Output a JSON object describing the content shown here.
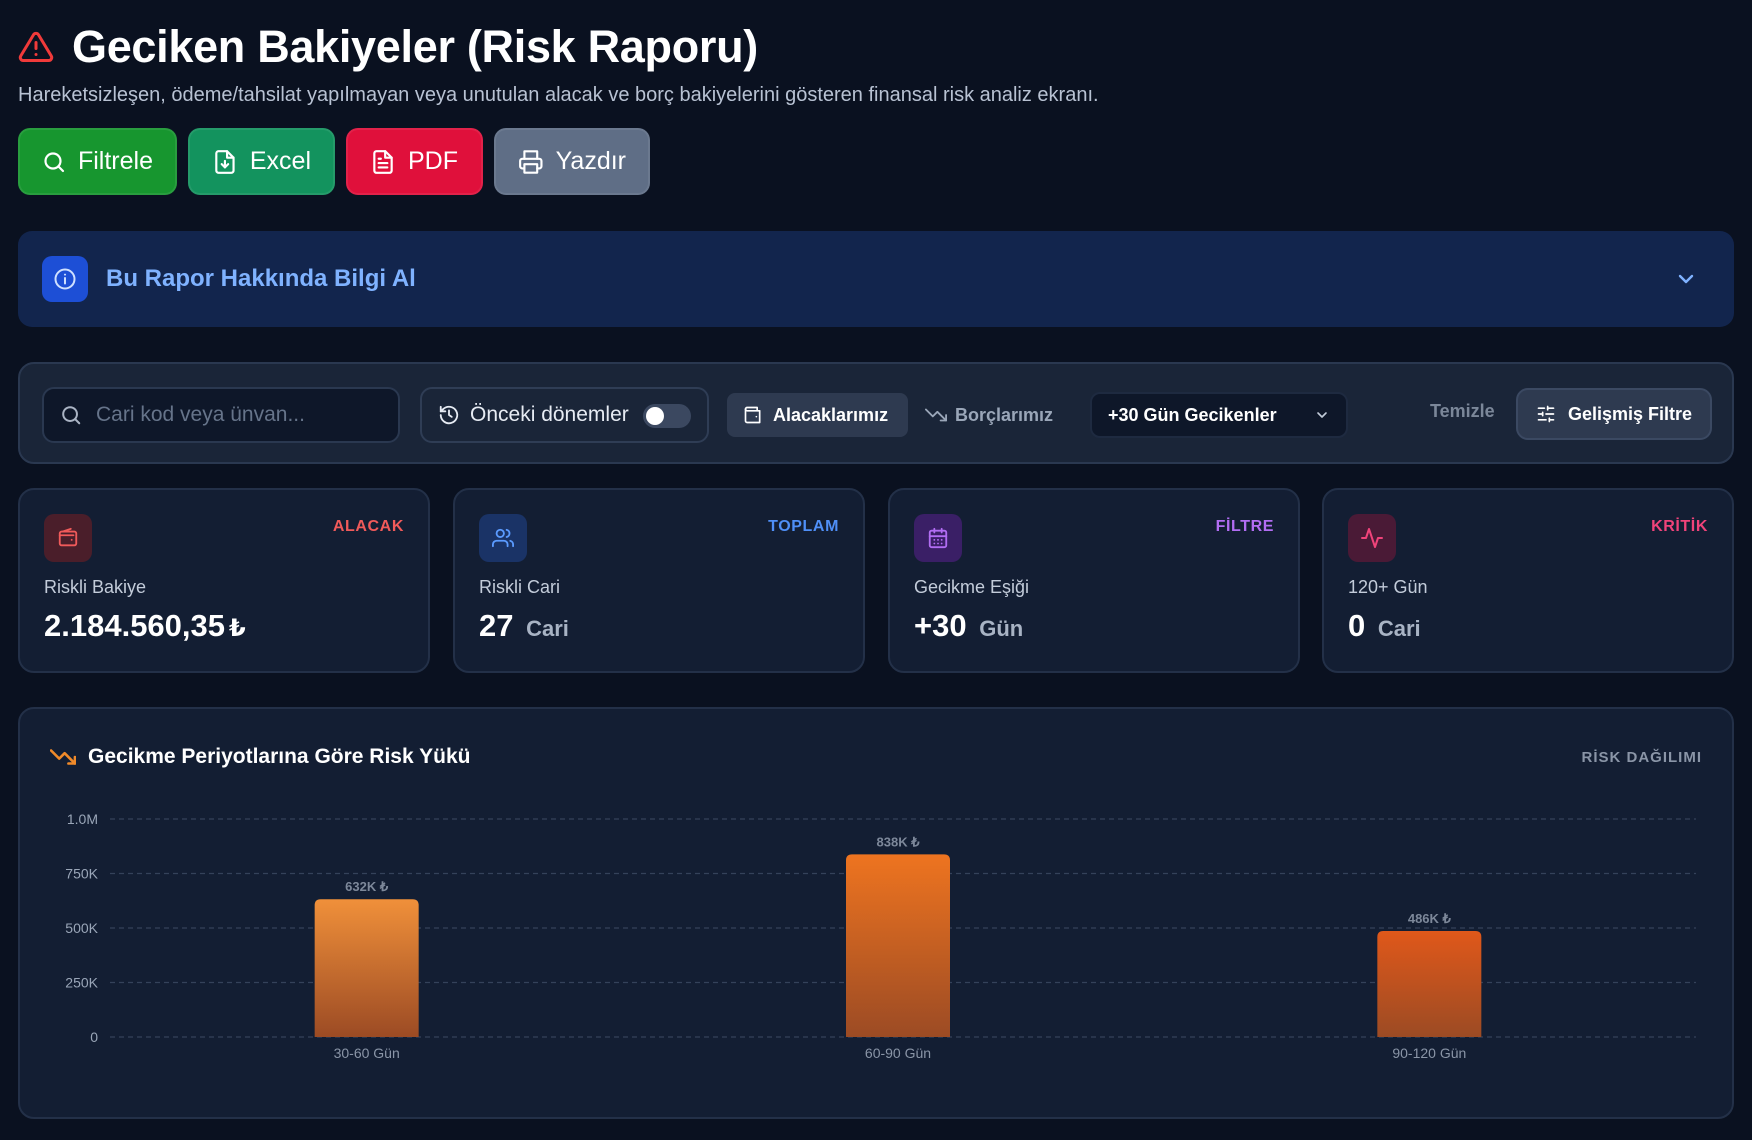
{
  "header": {
    "title": "Geciken Bakiyeler (Risk Raporu)",
    "subtitle": "Hareketsizleşen, ödeme/tahsilat yapılmayan veya unutulan alacak ve borç bakiyelerini gösteren finansal risk analiz ekranı."
  },
  "actions": {
    "filter_label": "Filtrele",
    "excel_label": "Excel",
    "pdf_label": "PDF",
    "print_label": "Yazdır"
  },
  "info": {
    "title": "Bu Rapor Hakkında Bilgi Al"
  },
  "filters": {
    "search_placeholder": "Cari kod veya ünvan...",
    "previous_periods_label": "Önceki dönemler",
    "previous_periods_on": false,
    "receivables_label": "Alacaklarımız",
    "payables_label": "Borçlarımız",
    "overdue_select": "+30 Gün Gecikenler",
    "clear_label": "Temizle",
    "advanced_label": "Gelişmiş Filtre"
  },
  "cards": [
    {
      "tag": "ALACAK",
      "label": "Riskli Bakiye",
      "value": "2.184.560,35",
      "unit": "₺",
      "accent": "#f05a5a",
      "icon": "wallet-icon"
    },
    {
      "tag": "TOPLAM",
      "label": "Riskli Cari",
      "value": "27",
      "unit": "Cari",
      "accent": "#4f8ff7",
      "icon": "users-icon"
    },
    {
      "tag": "FİLTRE",
      "label": "Gecikme Eşiği",
      "value": "+30",
      "unit": "Gün",
      "accent": "#b26df3",
      "icon": "calendar-icon"
    },
    {
      "tag": "KRİTİK",
      "label": "120+ Gün",
      "value": "0",
      "unit": "Cari",
      "accent": "#f0437a",
      "icon": "activity-icon"
    }
  ],
  "chart": {
    "title": "Gecikme Periyotlarına Göre Risk Yükü",
    "tag": "RİSK DAĞILIMI"
  },
  "chart_data": {
    "type": "bar",
    "categories": [
      "30-60 Gün",
      "60-90 Gün",
      "90-120 Gün"
    ],
    "values": [
      632000,
      838000,
      486000
    ],
    "data_labels": [
      "632K ₺",
      "838K ₺",
      "486K ₺"
    ],
    "yticks": [
      0,
      250000,
      500000,
      750000,
      1000000
    ],
    "ytick_labels": [
      "0",
      "250K",
      "500K",
      "750K",
      "1.0M"
    ],
    "ylim": [
      0,
      1000000
    ],
    "grid": true,
    "colors": [
      "#f0903a",
      "#ee7420",
      "#e0581a"
    ]
  }
}
